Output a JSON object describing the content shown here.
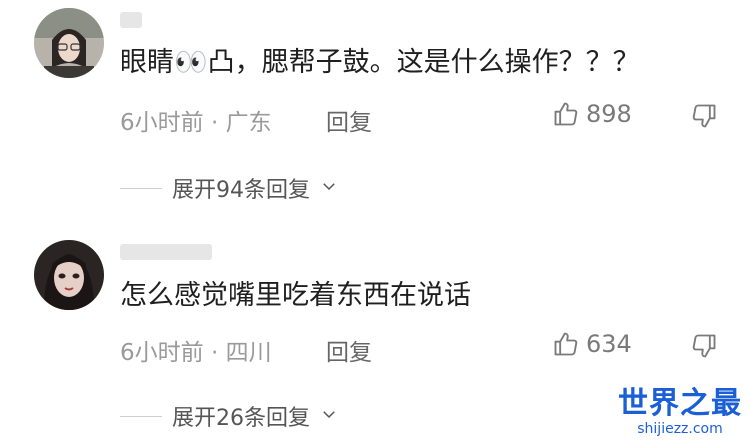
{
  "comments": [
    {
      "text": "眼睛👀凸，腮帮子鼓。这是什么操作？？？",
      "meta": "6小时前 · 广东",
      "reply_label": "回复",
      "likes": "898",
      "expand_label": "展开94条回复"
    },
    {
      "text": "怎么感觉嘴里吃着东西在说话",
      "meta": "6小时前 · 四川",
      "reply_label": "回复",
      "likes": "634",
      "expand_label": "展开26条回复"
    }
  ],
  "watermark": {
    "title": "世界之最",
    "url": "shijiezz.com"
  },
  "icons": {
    "like": "thumbs-up-icon",
    "dislike": "thumbs-down-icon",
    "expand": "chevron-down-icon"
  }
}
